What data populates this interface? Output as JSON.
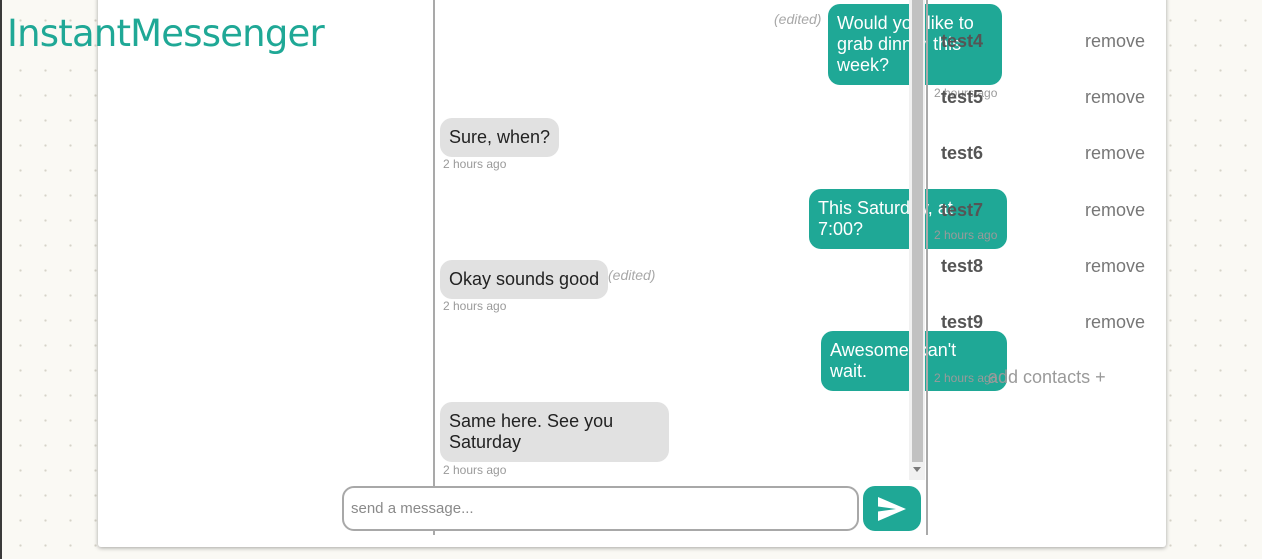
{
  "app": {
    "logo_text": "InstantMessenger",
    "accent_color": "#1fa896"
  },
  "chat": {
    "messages": [
      {
        "direction": "sent",
        "text": "Would you like to grab dinner this week?",
        "time": "2 hours ago",
        "edited": "(edited)"
      },
      {
        "direction": "received",
        "text": "Sure, when?",
        "time": "2 hours ago"
      },
      {
        "direction": "sent",
        "text": "This Saturday, at 7:00?",
        "time": "2 hours ago"
      },
      {
        "direction": "received",
        "text": "Okay sounds good",
        "time": "2 hours ago",
        "edited": "(edited)"
      },
      {
        "direction": "sent",
        "text": "Awesome, can't wait.",
        "time": "2 hours ago"
      },
      {
        "direction": "received",
        "text": "Same here. See you Saturday",
        "time": "2 hours ago"
      }
    ],
    "input": {
      "placeholder": "send a message...",
      "value": ""
    },
    "send_icon": "send-arrow-icon"
  },
  "contacts": {
    "items": [
      {
        "name": "test4",
        "action": "remove"
      },
      {
        "name": "test5",
        "action": "remove"
      },
      {
        "name": "test6",
        "action": "remove"
      },
      {
        "name": "test7",
        "action": "remove"
      },
      {
        "name": "test8",
        "action": "remove"
      },
      {
        "name": "test9",
        "action": "remove"
      }
    ],
    "add_label": "add contacts +"
  }
}
